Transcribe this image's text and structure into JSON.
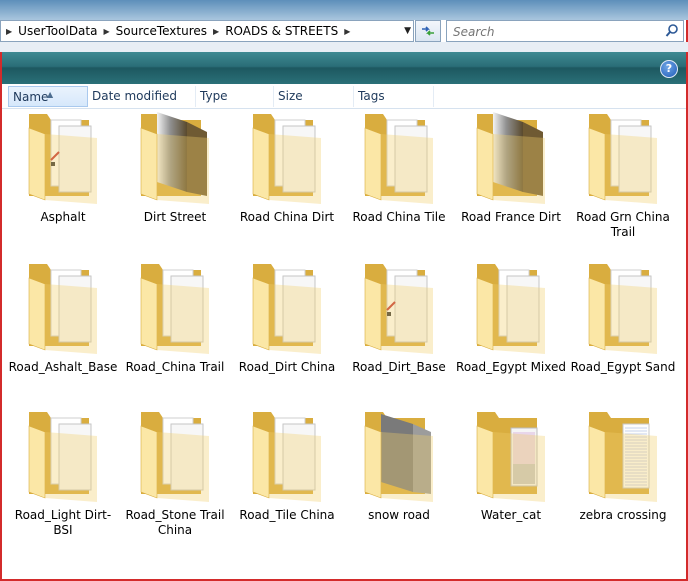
{
  "breadcrumb": [
    "UserToolData",
    "SourceTextures",
    "ROADS & STREETS"
  ],
  "search": {
    "placeholder": "Search"
  },
  "help": {
    "label": "?"
  },
  "columns": [
    {
      "label": "Name",
      "sorted": true
    },
    {
      "label": "Date modified"
    },
    {
      "label": "Type"
    },
    {
      "label": "Size"
    },
    {
      "label": "Tags"
    }
  ],
  "folders": [
    {
      "name": "Asphalt",
      "preview": "asphalt"
    },
    {
      "name": "Dirt Street",
      "preview": "dirt-dark"
    },
    {
      "name": "Road China Dirt",
      "preview": "docs"
    },
    {
      "name": "Road China Tile",
      "preview": "docs"
    },
    {
      "name": "Road France Dirt",
      "preview": "dirt-dark"
    },
    {
      "name": "Road Grn China Trail",
      "preview": "docs"
    },
    {
      "name": "Road_Ashalt_Base",
      "preview": "docs"
    },
    {
      "name": "Road_China Trail",
      "preview": "docs"
    },
    {
      "name": "Road_Dirt China",
      "preview": "docs"
    },
    {
      "name": "Road_Dirt_Base",
      "preview": "asphalt"
    },
    {
      "name": "Road_Egypt Mixed",
      "preview": "docs"
    },
    {
      "name": "Road_Egypt Sand",
      "preview": "docs"
    },
    {
      "name": "Road_Light Dirt-BSI",
      "preview": "docs"
    },
    {
      "name": "Road_Stone Trail China",
      "preview": "docs"
    },
    {
      "name": "Road_Tile China",
      "preview": "docs"
    },
    {
      "name": "snow road",
      "preview": "gray"
    },
    {
      "name": "Water_cat",
      "preview": "water"
    },
    {
      "name": "zebra crossing",
      "preview": "lined"
    }
  ],
  "colors": {
    "folder_light": "#fbe7a6",
    "folder_mid": "#f1cf6b",
    "folder_dark": "#d9ad3f",
    "toolbar": "#2a6d77",
    "frame": "#d32b2b"
  }
}
